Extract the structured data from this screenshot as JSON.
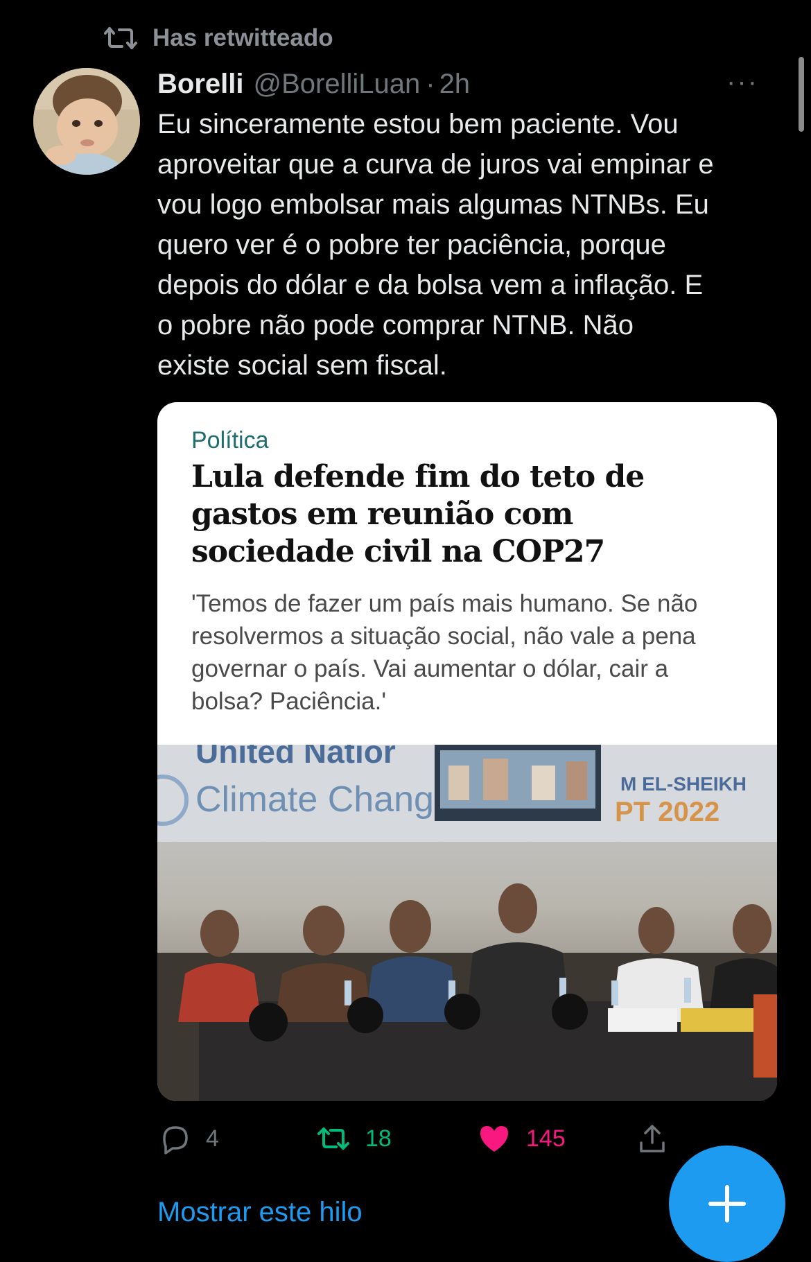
{
  "retweet": {
    "label": "Has retwitteado"
  },
  "tweet": {
    "author_name": "Borelli",
    "author_handle": "@BorelliLuan",
    "separator": "·",
    "time": "2h",
    "more": "···",
    "text": "Eu sinceramente estou bem paciente. Vou\naproveitar que a curva de juros vai empinar e\nvou logo embolsar mais algumas NTNBs. Eu\nquero ver é o pobre ter paciência, porque\ndepois do dólar e da bolsa vem a inflação. E\no pobre não pode comprar NTNB. Não\nexiste social sem fiscal."
  },
  "card": {
    "section": "Política",
    "headline": "Lula defende fim do teto de gastos em reunião com sociedade civil na COP27",
    "subtitle": "'Temos de fazer um país mais humano. Se não resolvermos a situação social, não vale a pena governar o país. Vai aumentar o dólar, cair a bolsa? Paciência.'",
    "photo_text": {
      "un_line1": "United Natior",
      "un_line2": "Climate Chang",
      "city": "M EL-SHEIKH",
      "year": "PT 2022"
    }
  },
  "actions": {
    "reply_count": "4",
    "retweet_count": "18",
    "like_count": "145"
  },
  "show_thread": "Mostrar este hilo",
  "colors": {
    "accent": "#1d9bf0",
    "retweet_active": "#00ba7c",
    "like_active": "#f91880",
    "muted": "#71767b"
  }
}
